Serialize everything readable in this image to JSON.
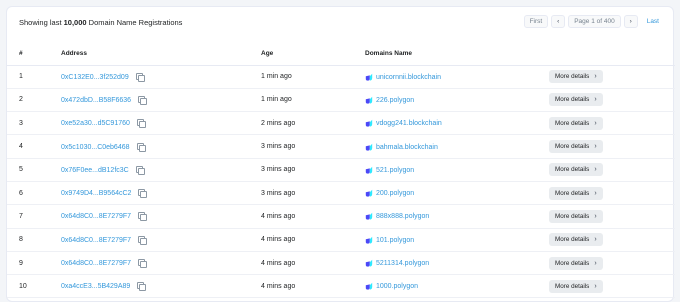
{
  "summary": {
    "prefix": "Showing last ",
    "count": "10,000",
    "suffix": " Domain Name Registrations"
  },
  "pager": {
    "first": "First",
    "prev_icon": "‹",
    "current": "Page 1 of 400",
    "next_icon": "›",
    "last": "Last"
  },
  "columns": {
    "index": "#",
    "address": "Address",
    "age": "Age",
    "domains": "Domains Name",
    "actions": ""
  },
  "more_label": "More details",
  "more_icon": "›",
  "rows": [
    {
      "index": "1",
      "address": "0xC132E0...3f252d09",
      "age": "1 min ago",
      "domain": "unicornnii.blockchain"
    },
    {
      "index": "2",
      "address": "0x472dbD...B58F6636",
      "age": "1 min ago",
      "domain": "226.polygon"
    },
    {
      "index": "3",
      "address": "0xe52a30...d5C91760",
      "age": "2 mins ago",
      "domain": "vdogg241.blockchain"
    },
    {
      "index": "4",
      "address": "0x5c1030...C0eb6468",
      "age": "3 mins ago",
      "domain": "bahmala.blockchain"
    },
    {
      "index": "5",
      "address": "0x76F0ee...dB12fc3C",
      "age": "3 mins ago",
      "domain": "521.polygon"
    },
    {
      "index": "6",
      "address": "0x9749D4...B9564cC2",
      "age": "3 mins ago",
      "domain": "200.polygon"
    },
    {
      "index": "7",
      "address": "0x64d8C0...8E7279F7",
      "age": "4 mins ago",
      "domain": "888x888.polygon"
    },
    {
      "index": "8",
      "address": "0x64d8C0...8E7279F7",
      "age": "4 mins ago",
      "domain": "101.polygon"
    },
    {
      "index": "9",
      "address": "0x64d8C0...8E7279F7",
      "age": "4 mins ago",
      "domain": "5211314.polygon"
    },
    {
      "index": "10",
      "address": "0xa4ccE3...5B429A89",
      "age": "4 mins ago",
      "domain": "1000.polygon"
    }
  ],
  "colors": {
    "link": "#3498db",
    "text": "#1e2022",
    "border": "#e7eaf3",
    "button_bg": "#e9ecef"
  },
  "icons": {
    "copy": "copy-icon",
    "domain": "unstoppable-domains-icon"
  }
}
